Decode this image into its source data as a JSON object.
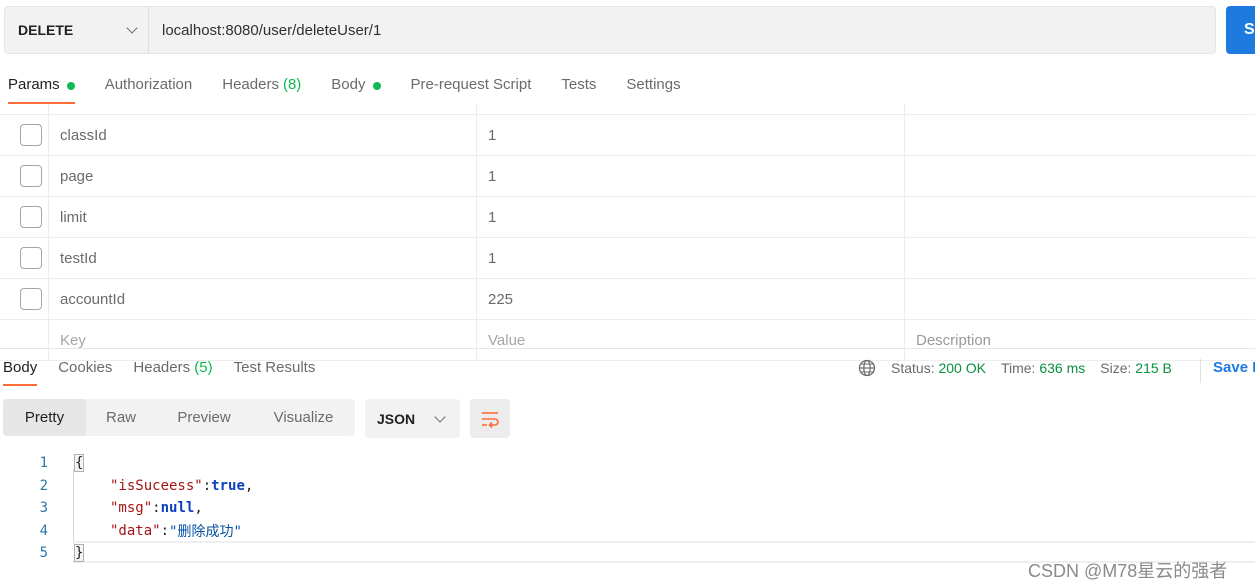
{
  "request": {
    "method": "DELETE",
    "url": "localhost:8080/user/deleteUser/1",
    "send_label": "S"
  },
  "request_tabs": [
    {
      "label": "Params",
      "dot": true,
      "active": true
    },
    {
      "label": "Authorization"
    },
    {
      "label": "Headers",
      "count": "(8)"
    },
    {
      "label": "Body",
      "dot": true
    },
    {
      "label": "Pre-request Script"
    },
    {
      "label": "Tests"
    },
    {
      "label": "Settings"
    }
  ],
  "params": {
    "rows": [
      {
        "key": "classId",
        "value": "1"
      },
      {
        "key": "page",
        "value": "1"
      },
      {
        "key": "limit",
        "value": "1"
      },
      {
        "key": "testId",
        "value": "1"
      },
      {
        "key": "accountId",
        "value": "225"
      }
    ],
    "placeholder": {
      "key": "Key",
      "value": "Value",
      "description": "Description"
    }
  },
  "response_tabs": [
    {
      "label": "Body",
      "active": true
    },
    {
      "label": "Cookies"
    },
    {
      "label": "Headers",
      "count": "(5)"
    },
    {
      "label": "Test Results"
    }
  ],
  "status": {
    "status_label": "Status:",
    "status_value": "200 OK",
    "time_label": "Time:",
    "time_value": "636 ms",
    "size_label": "Size:",
    "size_value": "215 B",
    "save_label": "Save Response"
  },
  "format": {
    "options": [
      "Pretty",
      "Raw",
      "Preview",
      "Visualize"
    ],
    "active": "Pretty",
    "language": "JSON"
  },
  "code": {
    "line_numbers": [
      "1",
      "2",
      "3",
      "4",
      "5"
    ],
    "open_brace": "{",
    "close_brace": "}",
    "entries": [
      {
        "key": "\"isSuceess\"",
        "value": "true",
        "type": "bool",
        "comma": ","
      },
      {
        "key": "\"msg\"",
        "value": "null",
        "type": "bool",
        "comma": ","
      },
      {
        "key": "\"data\"",
        "value": "\"删除成功\"",
        "type": "string",
        "comma": ""
      }
    ]
  },
  "watermark": "CSDN @M78星云的强者",
  "colors": {
    "accent": "#ff6c37",
    "send": "#1f7ae0",
    "success": "#0cbb52"
  }
}
